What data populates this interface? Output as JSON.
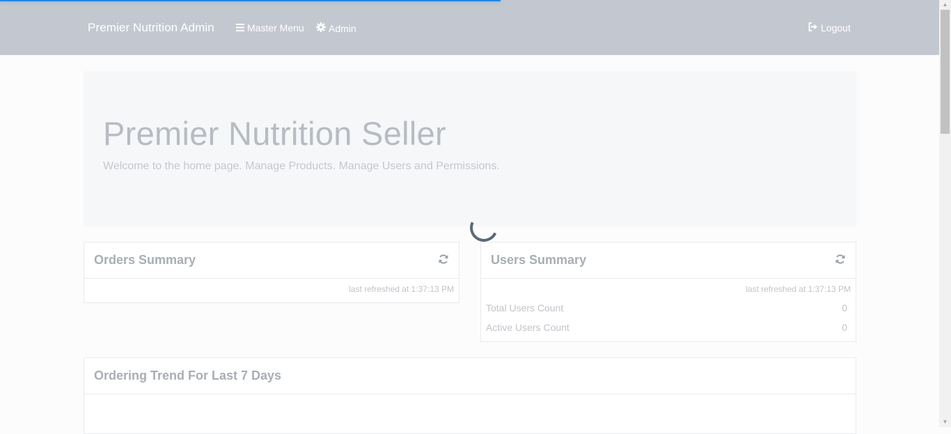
{
  "navbar": {
    "brand": "Premier Nutrition Admin",
    "master_menu": "Master Menu",
    "admin": "Admin",
    "logout": "Logout"
  },
  "jumbotron": {
    "title": "Premier Nutrition Seller",
    "lead": "Welcome to the home page. Manage Products. Manage Users and Permissions."
  },
  "orders_summary": {
    "title": "Orders Summary",
    "last_refreshed": "last refreshed at 1:37:13 PM"
  },
  "users_summary": {
    "title": "Users Summary",
    "last_refreshed": "last refreshed at 1:37:13 PM",
    "rows": [
      {
        "label": "Total Users Count",
        "value": "0"
      },
      {
        "label": "Active Users Count",
        "value": "0"
      }
    ]
  },
  "ordering_trend": {
    "title": "Ordering Trend For Last 7 Days"
  },
  "colors": {
    "navbar_bg": "#c3c8d0",
    "progress": "#1e88e5",
    "spinner": "#5c6876"
  },
  "icons": {
    "master_menu": "bars-icon",
    "admin": "gear-icon",
    "logout": "sign-out-icon",
    "refresh": "refresh-icon"
  }
}
